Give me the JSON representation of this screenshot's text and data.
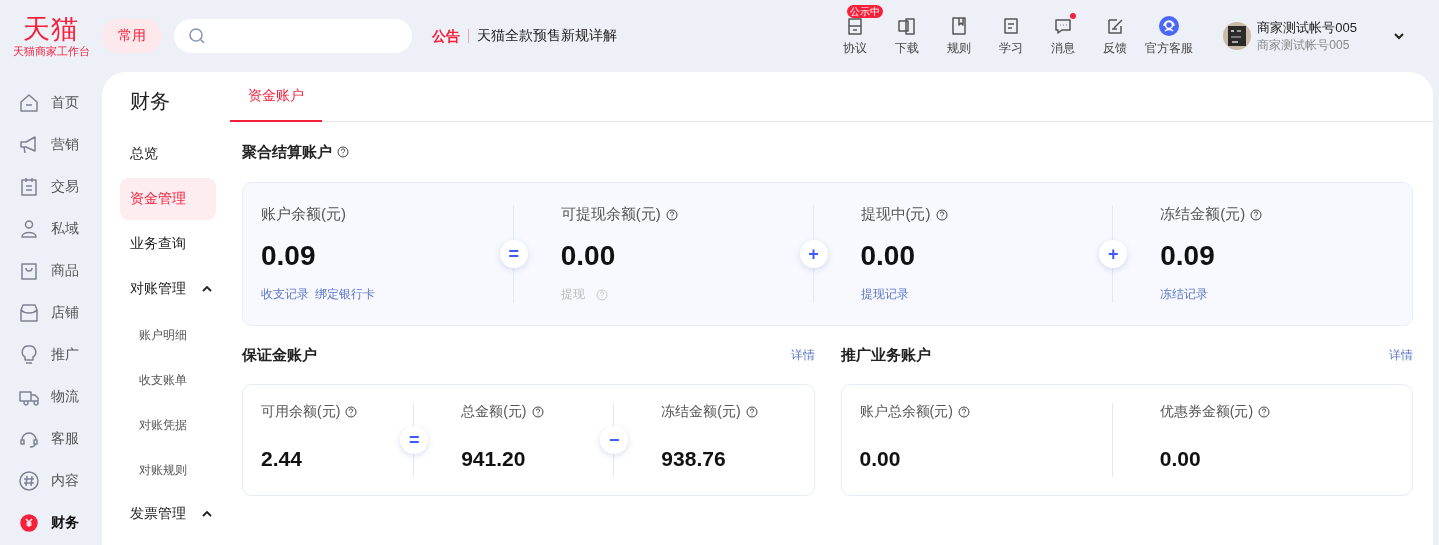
{
  "header": {
    "logo": {
      "name": "天猫",
      "subtitle": "天猫商家工作台"
    },
    "quick_button": "常用",
    "notice": {
      "label": "公告",
      "text": "天猫全款预售新规详解"
    },
    "tools": [
      {
        "label": "协议",
        "badge": "公示中",
        "dot": false
      },
      {
        "label": "下载",
        "dot": false
      },
      {
        "label": "规则",
        "dot": false
      },
      {
        "label": "学习",
        "dot": false
      },
      {
        "label": "消息",
        "dot": true
      },
      {
        "label": "反馈",
        "dot": false
      },
      {
        "label": "官方客服",
        "dot": false
      }
    ],
    "user": {
      "name": "商家测试帐号005",
      "account": "商家测试帐号005"
    }
  },
  "nav": [
    {
      "label": "首页",
      "selected": false
    },
    {
      "label": "营销",
      "selected": false
    },
    {
      "label": "交易",
      "selected": false
    },
    {
      "label": "私域",
      "selected": false
    },
    {
      "label": "商品",
      "selected": false
    },
    {
      "label": "店铺",
      "selected": false
    },
    {
      "label": "推广",
      "selected": false
    },
    {
      "label": "物流",
      "selected": false
    },
    {
      "label": "客服",
      "selected": false
    },
    {
      "label": "内容",
      "selected": false
    },
    {
      "label": "财务",
      "selected": true
    }
  ],
  "subnav": {
    "title": "财务",
    "items": [
      {
        "label": "总览",
        "selected": false
      },
      {
        "label": "资金管理",
        "selected": true
      },
      {
        "label": "业务查询",
        "selected": false
      },
      {
        "label": "对账管理",
        "selected": false,
        "expanded": true,
        "children": [
          {
            "label": "账户明细",
            "selected": false
          },
          {
            "label": "收支账单",
            "selected": false
          },
          {
            "label": "对账凭据",
            "selected": false
          },
          {
            "label": "对账规则",
            "selected": false
          }
        ]
      },
      {
        "label": "发票管理",
        "selected": false,
        "expanded": true
      }
    ]
  },
  "tabs": [
    {
      "label": "资金账户",
      "selected": true
    }
  ],
  "accounts": [
    {
      "kind": "wide",
      "title": "聚合结算账户",
      "help": true,
      "metrics": [
        {
          "label": "账户余额(元)",
          "help": false,
          "value": "0.09",
          "links": [
            {
              "text": "收支记录",
              "disabled": false,
              "help": false
            },
            {
              "text": "绑定银行卡",
              "disabled": false,
              "help": false
            }
          ]
        },
        {
          "op": "=",
          "label": "可提现余额(元)",
          "help": true,
          "value": "0.00",
          "links": [
            {
              "text": "提现",
              "disabled": true,
              "help": true
            }
          ]
        },
        {
          "op": "+",
          "label": "提现中(元)",
          "help": true,
          "value": "0.00",
          "links": [
            {
              "text": "提现记录",
              "disabled": false,
              "help": false
            }
          ]
        },
        {
          "op": "+",
          "label": "冻结金额(元)",
          "help": true,
          "value": "0.09",
          "links": [
            {
              "text": "冻结记录",
              "disabled": false,
              "help": false
            }
          ]
        }
      ]
    },
    {
      "kind": "half",
      "title": "保证金账户",
      "help": false,
      "detail": "详情",
      "metrics": [
        {
          "label": "可用余额(元)",
          "help": true,
          "value": "2.44"
        },
        {
          "op": "=",
          "label": "总金额(元)",
          "help": true,
          "value": "941.20"
        },
        {
          "op": "−",
          "label": "冻结金额(元)",
          "help": true,
          "value": "938.76"
        }
      ]
    },
    {
      "kind": "half",
      "title": "推广业务账户",
      "help": false,
      "detail": "详情",
      "metrics": [
        {
          "label": "账户总余额(元)",
          "help": true,
          "value": "0.00"
        },
        {
          "label": "优惠券金额(元)",
          "help": true,
          "value": "0.00"
        }
      ]
    }
  ]
}
